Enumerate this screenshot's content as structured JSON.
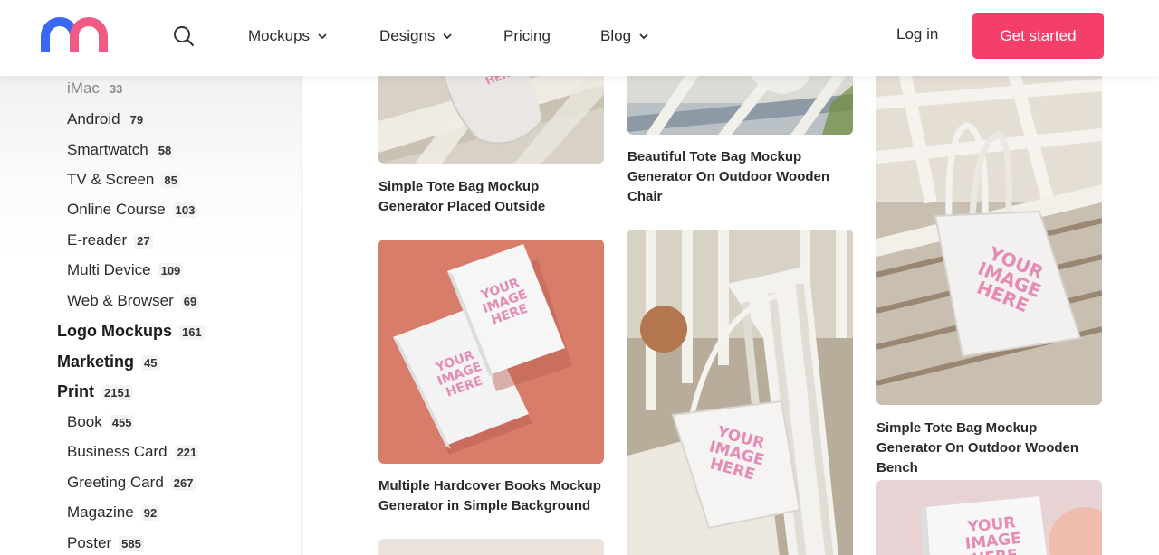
{
  "header": {
    "nav": [
      {
        "label": "Mockups",
        "has_dropdown": true
      },
      {
        "label": "Designs",
        "has_dropdown": true
      },
      {
        "label": "Pricing",
        "has_dropdown": false
      },
      {
        "label": "Blog",
        "has_dropdown": true
      }
    ],
    "login_label": "Log in",
    "cta_label": "Get started",
    "brand_colors": {
      "blue": "#3a67f5",
      "pink": "#f25a86",
      "cta": "#f43f6b"
    }
  },
  "sidebar": {
    "items": [
      {
        "label": "iMac",
        "count": "33",
        "level": "sub"
      },
      {
        "label": "Android",
        "count": "79",
        "level": "sub"
      },
      {
        "label": "Smartwatch",
        "count": "58",
        "level": "sub"
      },
      {
        "label": "TV & Screen",
        "count": "85",
        "level": "sub"
      },
      {
        "label": "Online Course",
        "count": "103",
        "level": "sub"
      },
      {
        "label": "E-reader",
        "count": "27",
        "level": "sub"
      },
      {
        "label": "Multi Device",
        "count": "109",
        "level": "sub"
      },
      {
        "label": "Web & Browser",
        "count": "69",
        "level": "sub"
      },
      {
        "label": "Logo Mockups",
        "count": "161",
        "level": "top"
      },
      {
        "label": "Marketing",
        "count": "45",
        "level": "top"
      },
      {
        "label": "Print",
        "count": "2151",
        "level": "top"
      },
      {
        "label": "Book",
        "count": "455",
        "level": "sub"
      },
      {
        "label": "Business Card",
        "count": "221",
        "level": "sub"
      },
      {
        "label": "Greeting Card",
        "count": "267",
        "level": "sub"
      },
      {
        "label": "Magazine",
        "count": "92",
        "level": "sub"
      },
      {
        "label": "Poster",
        "count": "585",
        "level": "sub"
      }
    ]
  },
  "grid": {
    "cards": [
      {
        "title": "Simple Tote Bag Mockup Generator Placed Outside"
      },
      {
        "title": "Beautiful Tote Bag Mockup Generator On Outdoor Wooden Chair"
      },
      {
        "title": "Simple Tote Bag Mockup Generator On Outdoor Wooden Bench",
        "mock_text": "YOUR IMAGE HERE"
      },
      {
        "title": "Multiple Hardcover Books Mockup Generator in Simple Background",
        "mock_text": "YOUR IMAGE HERE"
      },
      {
        "title": "",
        "mock_text": "YOUR IMAGE HERE"
      },
      {
        "title": "",
        "mock_text": "YOUR IMAGE HERE"
      },
      {
        "title": ""
      }
    ]
  }
}
